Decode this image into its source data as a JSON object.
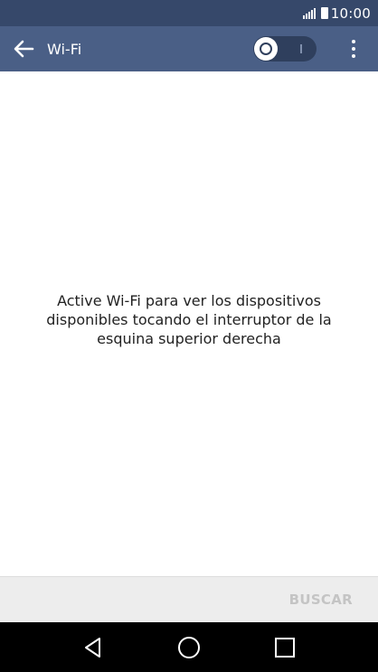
{
  "status_bar": {
    "time": "10:00",
    "signal_icon": "signal-icon",
    "battery_icon": "battery-icon"
  },
  "app_bar": {
    "title": "Wi-Fi",
    "back_icon": "arrow-left-icon",
    "toggle_state": "off",
    "menu_icon": "more-vert-icon"
  },
  "main": {
    "message": "Active Wi-Fi para ver los dispositivos disponibles tocando el interruptor de la esquina superior derecha"
  },
  "bottom_bar": {
    "search_label": "BUSCAR"
  },
  "nav_bar": {
    "back_icon": "triangle-back-icon",
    "home_icon": "circle-home-icon",
    "recents_icon": "square-recents-icon"
  },
  "colors": {
    "status_bar": "#36486a",
    "app_bar": "#4a5f86",
    "bottom_bar": "#ededed",
    "disabled_text": "#c4c4c4"
  }
}
